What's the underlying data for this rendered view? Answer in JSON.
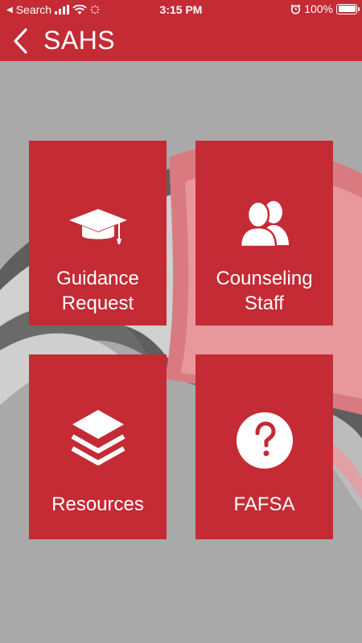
{
  "status_bar": {
    "back_app": "Search",
    "time": "3:15 PM",
    "battery": "100%"
  },
  "nav": {
    "title": "SAHS"
  },
  "tiles": [
    {
      "label_line1": "Guidance",
      "label_line2": "Request",
      "icon": "graduation-cap-icon"
    },
    {
      "label_line1": "Counseling",
      "label_line2": "Staff",
      "icon": "people-icon"
    },
    {
      "label_line1": "Resources",
      "icon": "layers-icon"
    },
    {
      "label_line1": "FAFSA",
      "icon": "question-circle-icon"
    }
  ],
  "colors": {
    "brand_red": "#c42b35",
    "background_gray": "#a9a9a9"
  }
}
